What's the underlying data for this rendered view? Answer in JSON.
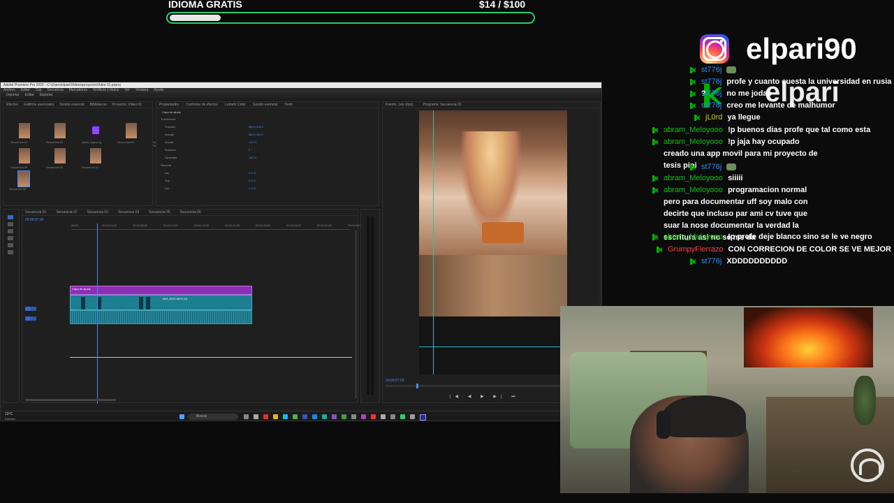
{
  "goal": {
    "title": "IDIOMA GRATIS",
    "amount": "$14  / $100",
    "progress_percent": 14
  },
  "instagram": {
    "handle": "elpari90",
    "icon": "instagram-icon"
  },
  "overlay_ghost_text": "elpari",
  "chat": [
    {
      "user": "st776j",
      "color": "#1e90ff",
      "text": "",
      "emote": "frog-emote"
    },
    {
      "user": "st776j",
      "color": "#1e90ff",
      "text": "profe y cuanto cuesta la universidad en rusia ?"
    },
    {
      "user": "st776j",
      "color": "#1e90ff",
      "text": "no me jodas"
    },
    {
      "user": "st776j",
      "color": "#1e90ff",
      "text": "creo me levante de malhumor"
    },
    {
      "user": "jL0rd",
      "color": "#c8c800",
      "text": "ya llegue"
    },
    {
      "user": "abram_Meloyooo",
      "color": "#00c200",
      "text": "!p buenos dias profe que tal como esta"
    },
    {
      "user": "abram_Meloyooo",
      "color": "#00c200",
      "text": "!p jaja hay ocupado creado una app movil para mi proyecto de tesis pipi"
    },
    {
      "user": "st776j",
      "color": "#1e90ff",
      "text": "",
      "emote": "frog-emote"
    },
    {
      "user": "abram_Meloyooo",
      "color": "#00c200",
      "text": "siiiii"
    },
    {
      "user": "abram_Meloyooo",
      "color": "#00c200",
      "text": "programacion normal pero para documentar uff soy malo con decirte que incluso par ami cv tuve que suar la nose documentar la verdad la escritura asi no se me da"
    },
    {
      "user": "abram_Meloyooo",
      "color": "#00c200",
      "text": "!p profe deje blanco sino se le ve negro"
    },
    {
      "user": "GrumpyFierrazo",
      "color": "#ff3b3b",
      "text": "CON CORRECION DE COLOR SE VE MEJOR"
    },
    {
      "user": "st776j",
      "color": "#1e90ff",
      "text": "XDDDDDDDDDD"
    }
  ],
  "premiere": {
    "title": "Adobe Premiere Pro 2025 - C:\\Users\\elpari\\Videos\\proyecto\\Video 01.prproj",
    "menu": [
      "Archivo",
      "Editar",
      "Clip",
      "Secuencia",
      "Marcadores",
      "Gráficos y títulos",
      "Ver",
      "Ventana",
      "Ayuda"
    ],
    "workspace_tabs": [
      "Importar",
      "Editar",
      "Exportar"
    ],
    "project_tabs": [
      "Efectos",
      "Gráficos esenciales",
      "Sonido esencial",
      "Bibliotecas",
      "Proyecto: Video 01"
    ],
    "props_tabs": [
      "Propiedades",
      "Controles de efectos",
      "Lumetri Color",
      "Sonido esencial",
      "Texto"
    ],
    "props_title": "Capa de ajuste",
    "props_rows": [
      {
        "label": "Transformar",
        "value": ""
      },
      {
        "label": "Posición",
        "value": "960.0   540.0"
      },
      {
        "label": "Anclaje",
        "value": "960.0   540.0"
      },
      {
        "label": "Escala",
        "value": "100 %"
      },
      {
        "label": "Rotación",
        "value": "0 °"
      },
      {
        "label": "Opacidad",
        "value": "100 %"
      },
      {
        "label": "Recortar",
        "value": ""
      },
      {
        "label": "Izq",
        "value": "0.0 %"
      },
      {
        "label": "Sup",
        "value": "0.0 %"
      },
      {
        "label": "Der",
        "value": "0.0 %"
      }
    ],
    "monitor_tabs": [
      "Fuente: (sin clips)",
      "Programa: Secuencia 03"
    ],
    "sequence_tabs": [
      "Secuencia 01",
      "Secuencia 02",
      "Secuencia 03",
      "Secuencia 04",
      "Secuencia 05",
      "Secuencia 06"
    ],
    "timecode": "00;00;07;09",
    "program_timecode": "00;00;07;09",
    "ruler": [
      "00;00",
      "00;00;04;00",
      "00;00;08;00",
      "00;00;12;00",
      "00;00;16;00",
      "00;00;20;00",
      "00;00;24;00",
      "00;00;28;00",
      "00;00;32;00",
      "00;00;36;00"
    ],
    "adjustment_clip": "Capa de ajuste",
    "video_clip": "IMG_0231.MOV [V]",
    "thumbs": [
      {
        "label": "Secuencia 01"
      },
      {
        "label": "Secuencia 02"
      },
      {
        "label": "twitch_logo.png",
        "twitch": true
      },
      {
        "label": "Secuencia 03"
      },
      {
        "label": "Secuencia 04"
      },
      {
        "label": "Secuencia 05"
      },
      {
        "label": "Secuencia 06"
      },
      {
        "label": "Secuencia 07"
      },
      {
        "label": "Secuencia 08"
      }
    ],
    "taskbar": {
      "weather": "19°C",
      "weather_sub": "Nublado",
      "search": "Buscar"
    }
  },
  "colors": {
    "goal_border": "#2ecc71",
    "adjustment_clip": "#8b2fb5",
    "video_clip": "#1d7e91",
    "playhead": "#4c8bf5",
    "mod_badge": "#00ad03"
  }
}
